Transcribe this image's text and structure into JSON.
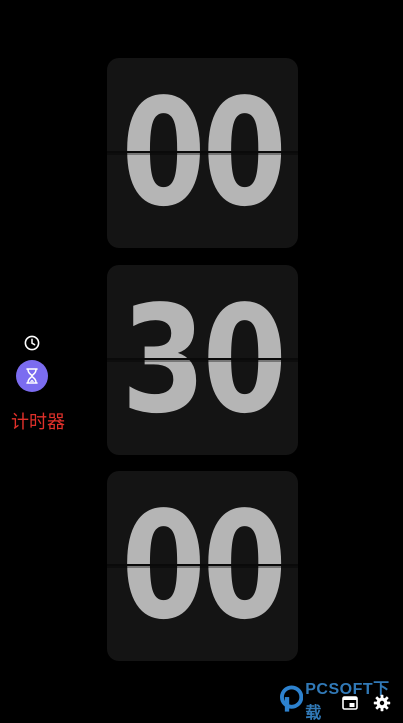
{
  "timer": {
    "hours": "00",
    "minutes": "30",
    "seconds": "00"
  },
  "sidebar": {
    "clock_icon": "clock-icon",
    "timer_icon": "hourglass-icon",
    "active_label": "计时器",
    "accent_color": "#7b6cf0",
    "label_color": "#e0302a"
  },
  "watermark": {
    "text": "PCSOFT下载"
  },
  "bottom_bar": {
    "lock_icon": "lock-window-icon",
    "settings_icon": "gear-icon"
  }
}
